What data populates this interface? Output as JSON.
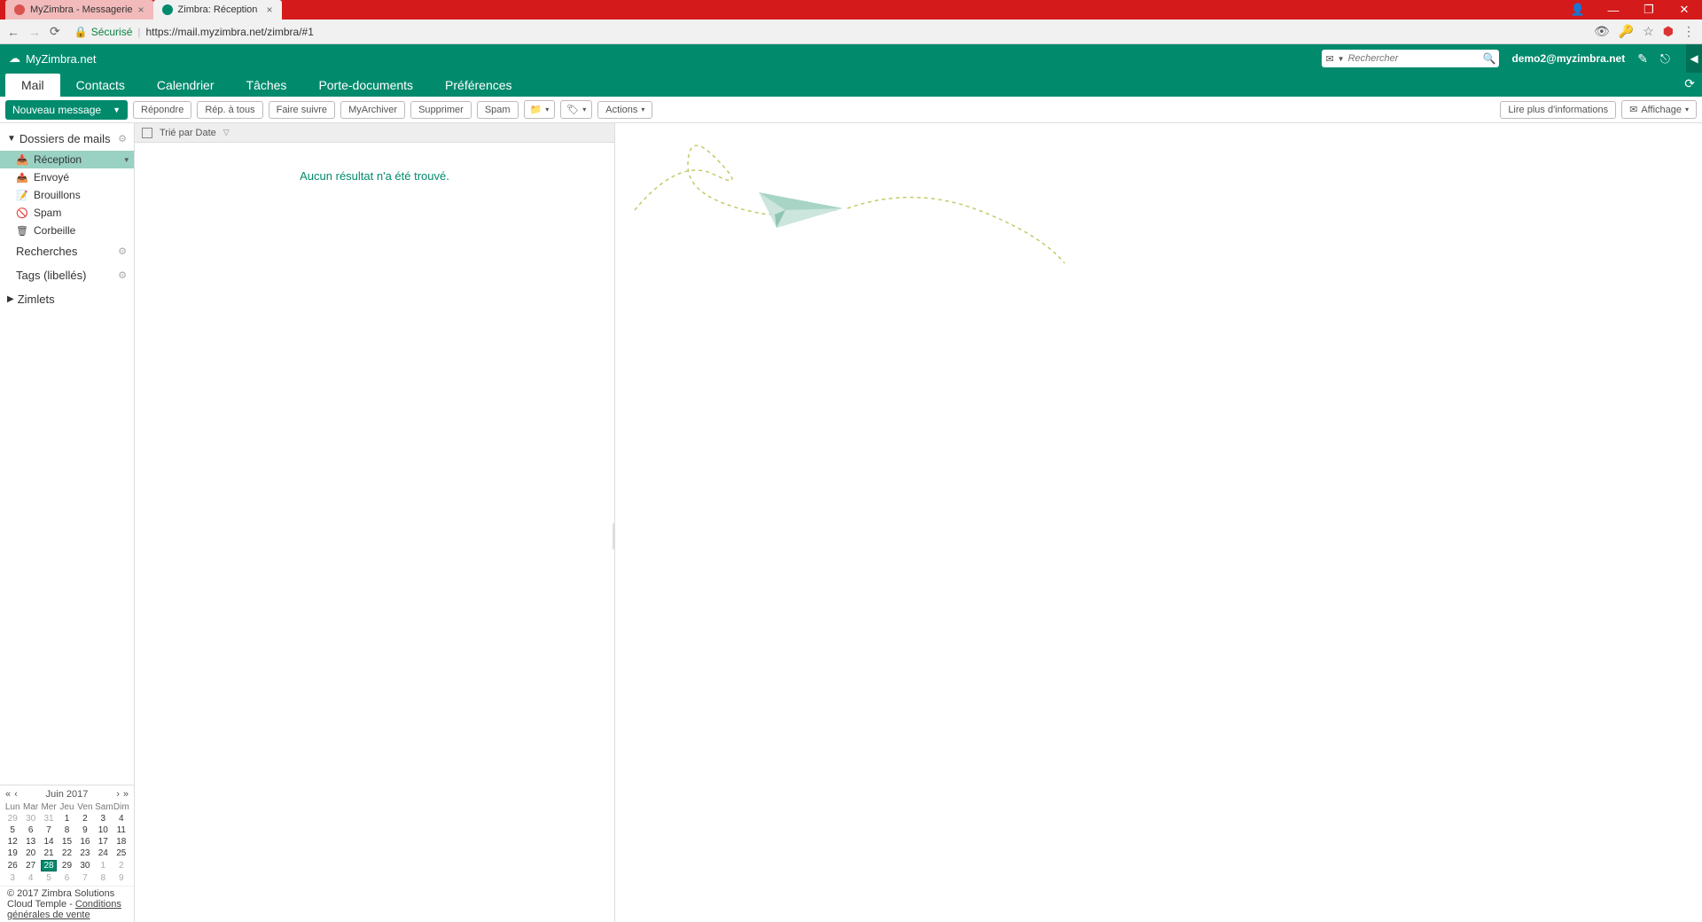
{
  "browser": {
    "tabs": [
      {
        "title": "MyZimbra - Messagerie",
        "active": false
      },
      {
        "title": "Zimbra: Réception",
        "active": true
      }
    ],
    "secure_label": "Sécurisé",
    "url": "https://mail.myzimbra.net/zimbra/#1"
  },
  "header": {
    "brand": "MyZimbra.net",
    "search_placeholder": "Rechercher",
    "user_email": "demo2@myzimbra.net"
  },
  "tabs": {
    "mail": "Mail",
    "contacts": "Contacts",
    "calendar": "Calendrier",
    "tasks": "Tâches",
    "briefcase": "Porte-documents",
    "preferences": "Préférences"
  },
  "toolbar": {
    "new_message": "Nouveau message",
    "reply": "Répondre",
    "reply_all": "Rép. à tous",
    "forward": "Faire suivre",
    "archive": "MyArchiver",
    "delete": "Supprimer",
    "spam": "Spam",
    "actions": "Actions",
    "read_more": "Lire plus d'informations",
    "view": "Affichage"
  },
  "sidebar": {
    "dossiers_title": "Dossiers de mails",
    "folders": {
      "inbox": "Réception",
      "sent": "Envoyé",
      "drafts": "Brouillons",
      "spam": "Spam",
      "trash": "Corbeille"
    },
    "searches": "Recherches",
    "tags": "Tags (libellés)",
    "zimlets": "Zimlets"
  },
  "list": {
    "sort_label": "Trié par Date",
    "no_result": "Aucun résultat n'a été trouvé."
  },
  "calendar": {
    "title": "Juin 2017",
    "days": [
      "Lun",
      "Mar",
      "Mer",
      "Jeu",
      "Ven",
      "Sam",
      "Dim"
    ],
    "weeks": [
      [
        {
          "d": "29",
          "o": true
        },
        {
          "d": "30",
          "o": true
        },
        {
          "d": "31",
          "o": true
        },
        {
          "d": "1"
        },
        {
          "d": "2"
        },
        {
          "d": "3"
        },
        {
          "d": "4"
        }
      ],
      [
        {
          "d": "5"
        },
        {
          "d": "6"
        },
        {
          "d": "7"
        },
        {
          "d": "8"
        },
        {
          "d": "9"
        },
        {
          "d": "10"
        },
        {
          "d": "11"
        }
      ],
      [
        {
          "d": "12"
        },
        {
          "d": "13"
        },
        {
          "d": "14"
        },
        {
          "d": "15"
        },
        {
          "d": "16"
        },
        {
          "d": "17"
        },
        {
          "d": "18"
        }
      ],
      [
        {
          "d": "19"
        },
        {
          "d": "20"
        },
        {
          "d": "21"
        },
        {
          "d": "22"
        },
        {
          "d": "23"
        },
        {
          "d": "24"
        },
        {
          "d": "25"
        }
      ],
      [
        {
          "d": "26"
        },
        {
          "d": "27"
        },
        {
          "d": "28",
          "t": true
        },
        {
          "d": "29"
        },
        {
          "d": "30"
        },
        {
          "d": "1",
          "o": true
        },
        {
          "d": "2",
          "o": true
        }
      ],
      [
        {
          "d": "3",
          "o": true
        },
        {
          "d": "4",
          "o": true
        },
        {
          "d": "5",
          "o": true
        },
        {
          "d": "6",
          "o": true
        },
        {
          "d": "7",
          "o": true
        },
        {
          "d": "8",
          "o": true
        },
        {
          "d": "9",
          "o": true
        }
      ]
    ]
  },
  "footer": {
    "copyright": "© 2017 Zimbra Solutions Cloud Temple - ",
    "cgv": "Conditions générales de vente"
  }
}
